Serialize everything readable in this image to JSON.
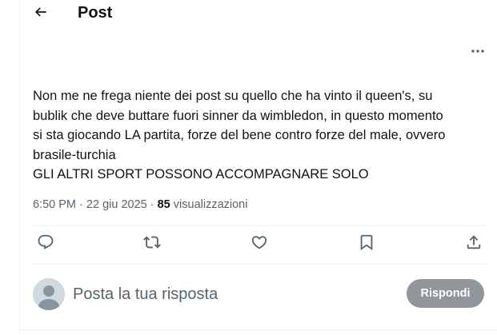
{
  "header": {
    "back_icon": "arrow-left-icon",
    "title": "Post"
  },
  "post": {
    "more_icon": "more-horizontal-icon",
    "text_lines": [
      "Non me ne frega niente dei post su quello che ha vinto il queen's, su",
      "bublik che deve buttare fuori sinner da wimbledon, in questo momento",
      "si sta giocando LA partita, forze del bene contro forze del male, ovvero",
      "brasile-turchia",
      "GLI ALTRI SPORT POSSONO ACCOMPAGNARE SOLO"
    ],
    "time": "6:50 PM",
    "dot": "·",
    "date": "22 giu 2025",
    "views_count": "85",
    "views_label": "visualizzazioni"
  },
  "actions": [
    {
      "name": "reply",
      "icon": "comment-icon"
    },
    {
      "name": "repost",
      "icon": "repost-icon"
    },
    {
      "name": "like",
      "icon": "heart-icon"
    },
    {
      "name": "bookmark",
      "icon": "bookmark-icon"
    },
    {
      "name": "share",
      "icon": "share-icon"
    }
  ],
  "composer": {
    "placeholder": "Posta la tua risposta",
    "reply_button": "Rispondi"
  },
  "colors": {
    "text": "#0f1419",
    "secondary": "#536471",
    "border": "#eff3f4",
    "reply_button_bg": "#8f979d"
  }
}
